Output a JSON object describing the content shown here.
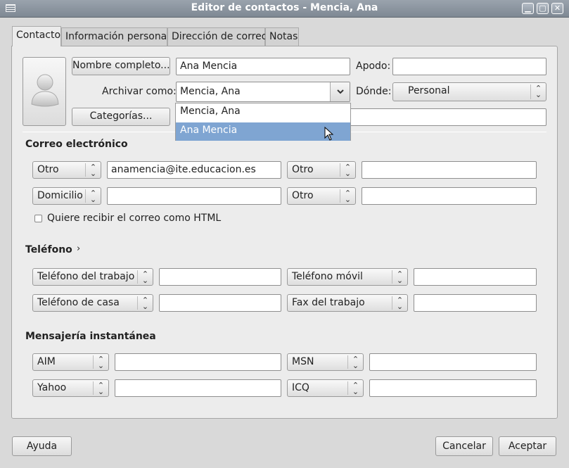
{
  "window": {
    "title": "Editor de contactos - Mencia, Ana",
    "minimize": "▁",
    "maximize": "▢",
    "close": "✕"
  },
  "tabs": [
    "Contacto",
    "Información personal",
    "Dirección de correo",
    "Notas"
  ],
  "contact": {
    "full_name_button": "Nombre completo...",
    "full_name_value": "Ana Mencia",
    "nickname_label": "Apodo:",
    "nickname_value": "",
    "file_as_label": "Archivar como:",
    "file_as_value": "Mencia, Ana",
    "where_label": "Dónde:",
    "where_value": "Personal",
    "categories_button": "Categorías...",
    "categories_value": "",
    "file_as_options": [
      "Mencia, Ana",
      "Ana Mencia"
    ],
    "file_as_hover_index": 1
  },
  "email": {
    "heading": "Correo electrónico",
    "rows": [
      {
        "type_left": "Otro",
        "value_left": "anamencia@ite.educacion.es",
        "type_right": "Otro",
        "value_right": ""
      },
      {
        "type_left": "Domicilio",
        "value_left": "",
        "type_right": "Otro",
        "value_right": ""
      }
    ],
    "html_checkbox_label": "Quiere recibir el correo como HTML",
    "html_checked": false
  },
  "phone": {
    "heading": "Teléfono",
    "expander": "›",
    "rows": [
      {
        "type_left": "Teléfono del trabajo",
        "value_left": "",
        "type_right": "Teléfono móvil",
        "value_right": ""
      },
      {
        "type_left": "Teléfono de casa",
        "value_left": "",
        "type_right": "Fax del trabajo",
        "value_right": ""
      }
    ]
  },
  "im": {
    "heading": "Mensajería instantánea",
    "rows": [
      {
        "type_left": "AIM",
        "value_left": "",
        "type_right": "MSN",
        "value_right": ""
      },
      {
        "type_left": "Yahoo",
        "value_left": "",
        "type_right": "ICQ",
        "value_right": ""
      }
    ]
  },
  "footer": {
    "help": "Ayuda",
    "cancel": "Cancelar",
    "accept": "Aceptar"
  },
  "icons": {
    "window_menu": "window-menu-icon",
    "avatar": "person-placeholder-icon",
    "select_arrows": "updown-arrows-icon",
    "combo_arrow": "chevron-down-icon",
    "cursor": "mouse-pointer-icon"
  },
  "colors": {
    "titlebar": "#8a939d",
    "dropdown_hover": "#7fa5d2",
    "window_bg": "#d9d9d9"
  }
}
